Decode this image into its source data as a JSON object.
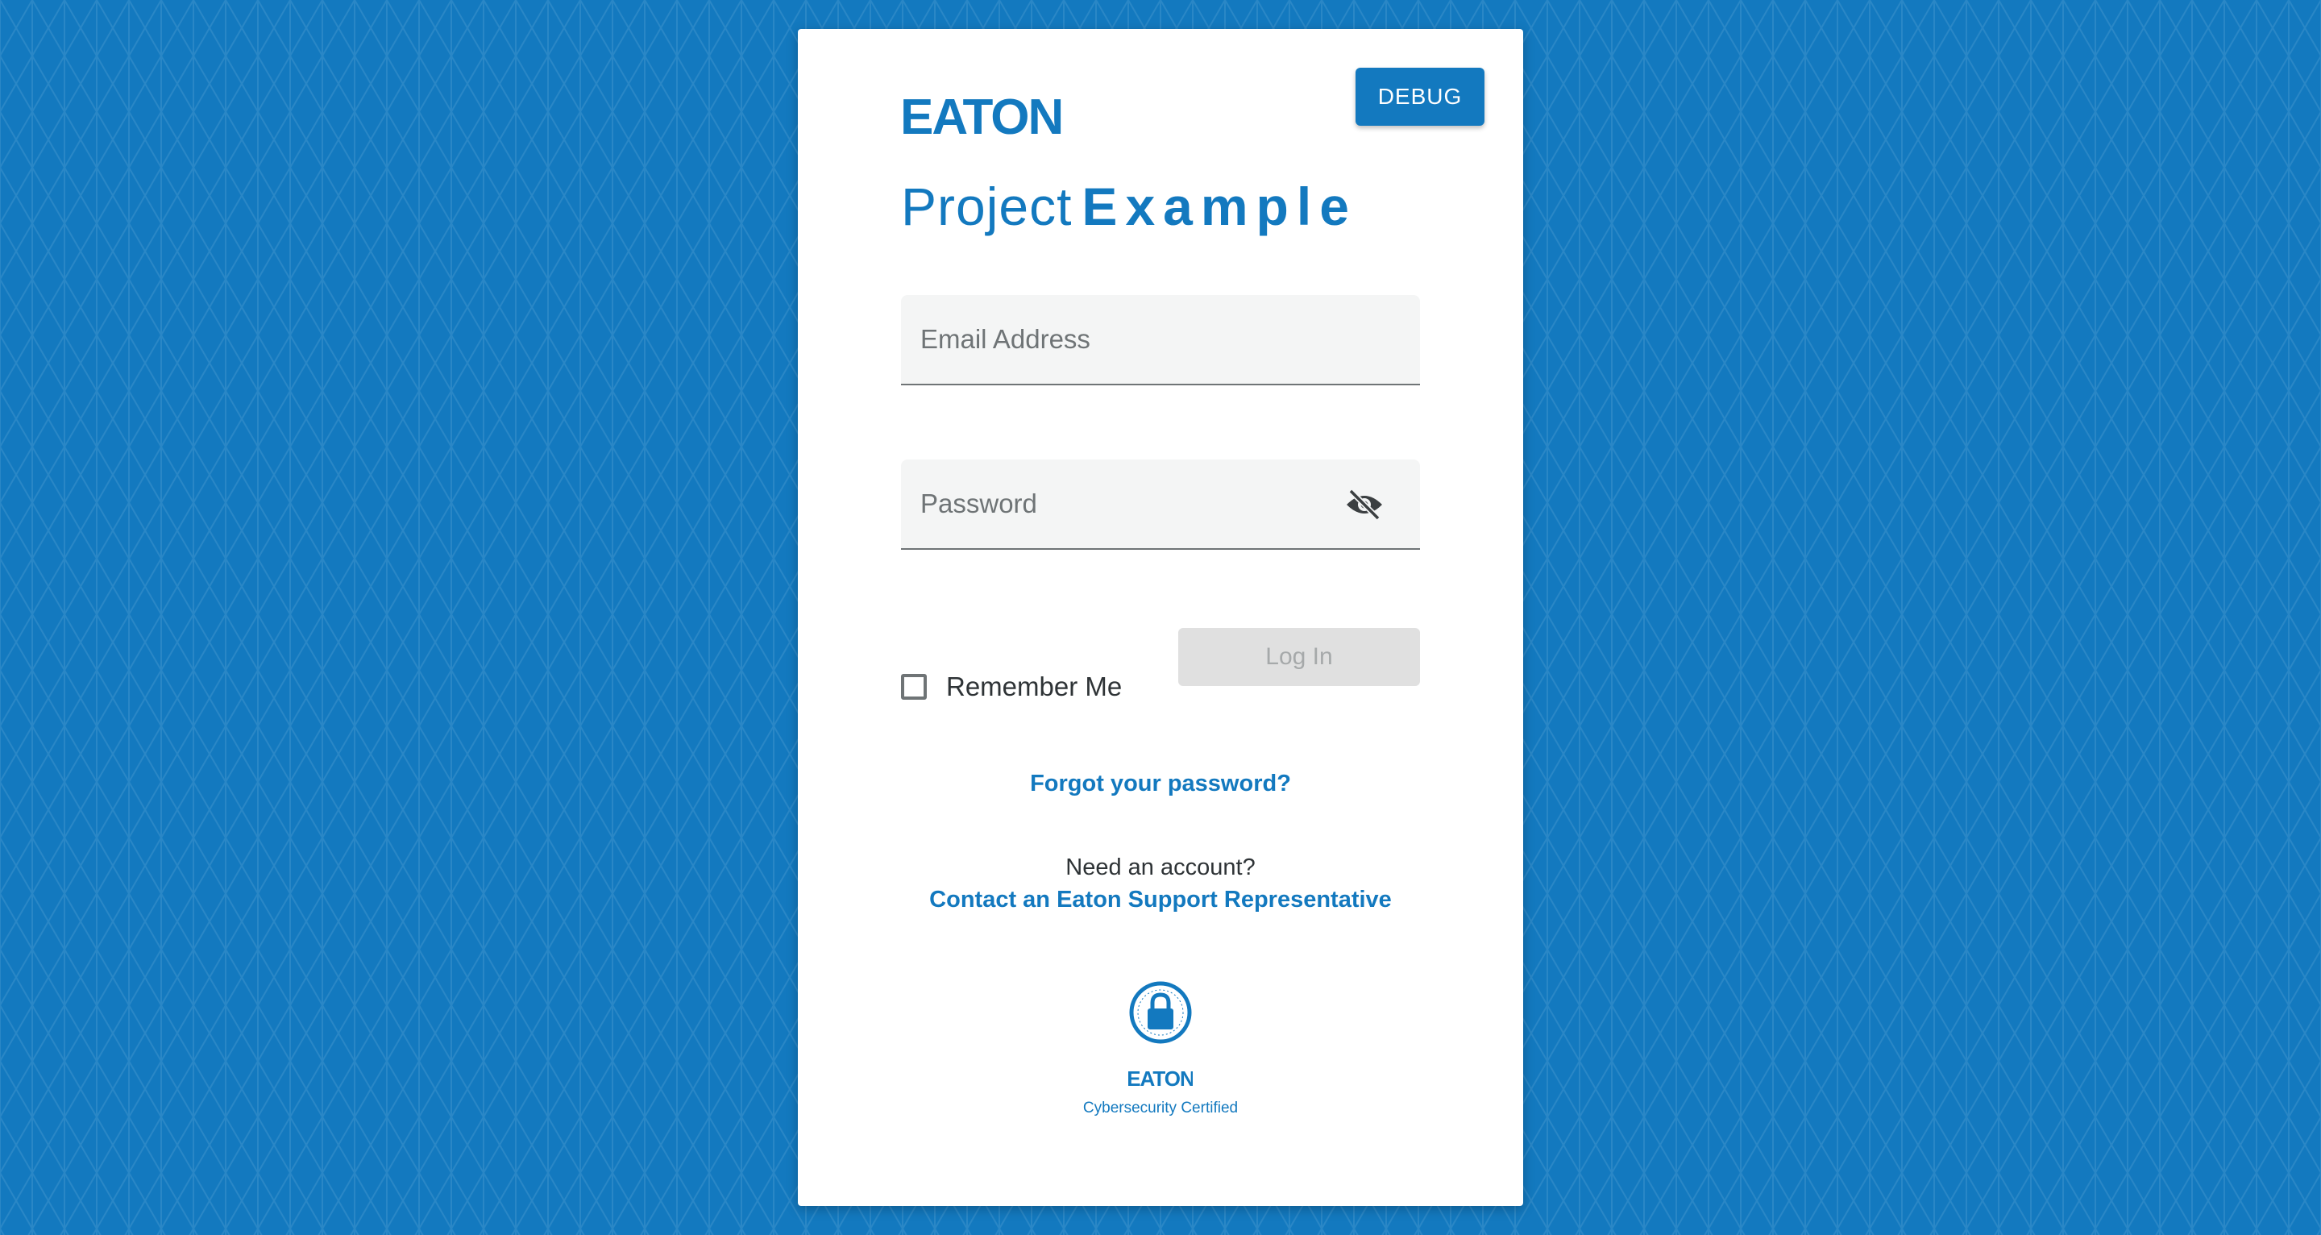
{
  "app": {
    "brand": "EATON",
    "title_light": "Project",
    "title_bold": "Example"
  },
  "toolbar": {
    "debug_label": "DEBUG"
  },
  "form": {
    "email_placeholder": "Email Address",
    "email_value": "",
    "password_placeholder": "Password",
    "password_value": "",
    "remember_label": "Remember Me",
    "remember_checked": false,
    "login_label": "Log In",
    "login_enabled": false
  },
  "links": {
    "forgot_password": "Forgot your password?",
    "need_account": "Need an account?",
    "contact": "Contact an Eaton Support Representative"
  },
  "certification": {
    "brand": "EATON",
    "label": "Cybersecurity Certified"
  },
  "icons": {
    "password_toggle": "eye-off-icon",
    "certification": "lock-icon"
  },
  "colors": {
    "brand_blue": "#1379bf",
    "background": "#1379bf",
    "card": "#ffffff",
    "field_bg": "#f4f5f5",
    "disabled_button": "#e0e0e0",
    "text_dark": "#2e3336"
  }
}
